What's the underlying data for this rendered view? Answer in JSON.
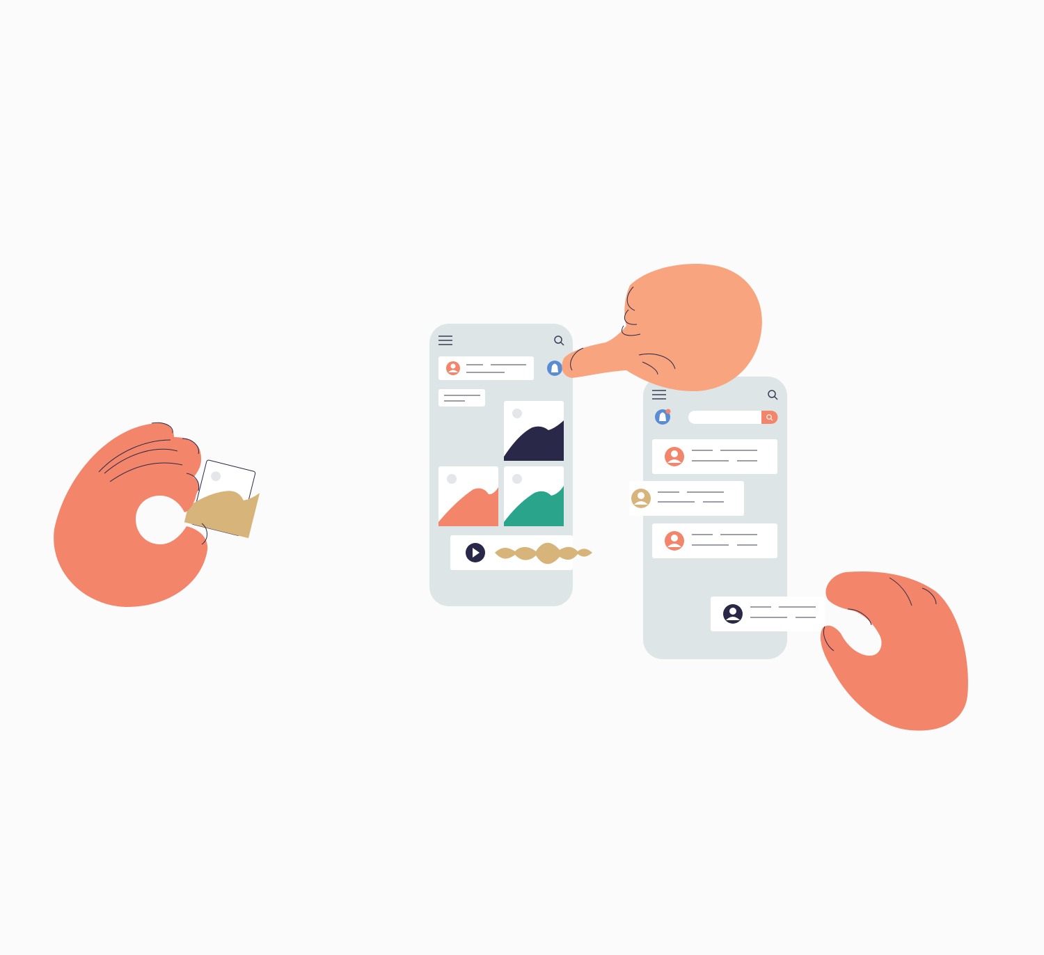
{
  "colors": {
    "background": "#fbfbfb",
    "phone": "#dde5e6",
    "card": "#ffffff",
    "skin_dark": "#f3866a",
    "skin_light": "#f8a47e",
    "navy": "#2a2848",
    "teal": "#2aa58c",
    "coral": "#f3866a",
    "gold": "#d6b47a",
    "blue": "#5a8cd6",
    "line": "#3b3b55"
  },
  "phone_left": {
    "menu_icon": "hamburger-icon",
    "search_icon": "search-icon",
    "notification_icon": "bell-icon",
    "profile_avatar_icon": "user-avatar-icon",
    "image_tiles": [
      "navy-mountain-image",
      "coral-mountain-image",
      "teal-mountain-image"
    ],
    "audio_player": {
      "play_icon": "play-icon",
      "waveform_icon": "waveform-icon"
    }
  },
  "phone_right": {
    "menu_icon": "hamburger-icon",
    "search_icon": "search-icon",
    "notification_icon": "bell-icon",
    "search_button_icon": "search-icon",
    "list_item_icons": [
      "coral-user-icon",
      "gold-user-icon",
      "coral-user-icon",
      "navy-user-icon"
    ]
  },
  "hands": [
    "left-hand-holding-image",
    "pointing-hand",
    "right-hand-holding-card"
  ]
}
